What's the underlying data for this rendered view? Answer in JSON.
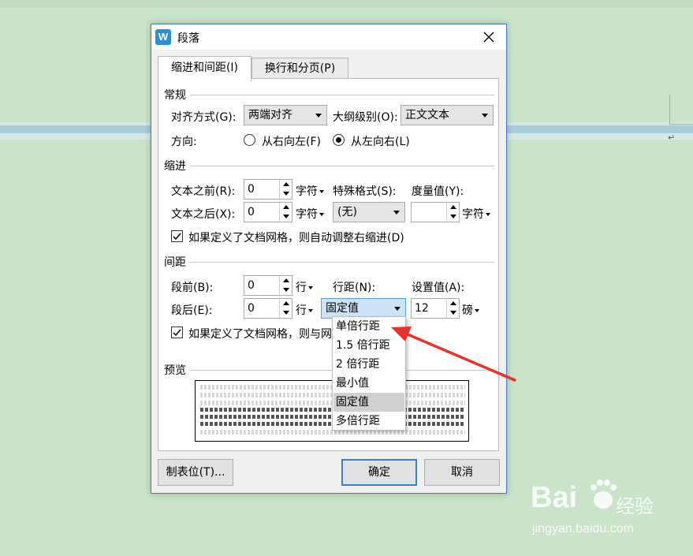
{
  "dialog": {
    "title": "段落",
    "app_icon_letter": "W",
    "tabs": [
      {
        "label": "缩进和间距(I)",
        "active": true
      },
      {
        "label": "换行和分页(P)",
        "active": false
      }
    ],
    "general": {
      "section_title": "常规",
      "align_label": "对齐方式(G):",
      "align_value": "两端对齐",
      "outline_label": "大纲级别(O):",
      "outline_value": "正文文本",
      "direction_label": "方向:",
      "rtl_label": "从右向左(F)",
      "ltr_label": "从左向右(L)",
      "direction_selected": "ltr"
    },
    "indent": {
      "section_title": "缩进",
      "before_label": "文本之前(R):",
      "before_value": "0",
      "before_unit": "字符",
      "after_label": "文本之后(X):",
      "after_value": "0",
      "after_unit": "字符",
      "special_label": "特殊格式(S):",
      "special_value": "(无)",
      "measure_label": "度量值(Y):",
      "measure_value": "",
      "measure_unit": "字符",
      "auto_adjust_label": "如果定义了文档网格，则自动调整右缩进(D)",
      "auto_adjust_checked": true
    },
    "spacing": {
      "section_title": "间距",
      "before_label": "段前(B):",
      "before_value": "0",
      "before_unit": "行",
      "after_label": "段后(E):",
      "after_value": "0",
      "after_unit": "行",
      "line_label": "行距(N):",
      "line_value": "固定值",
      "set_label": "设置值(A):",
      "set_value": "12",
      "set_unit": "磅",
      "grid_label": "如果定义了文档网格，则与网",
      "grid_checked": true
    },
    "preview": {
      "section_title": "预览"
    },
    "line_spacing_options": [
      "单倍行距",
      "1.5 倍行距",
      "2 倍行距",
      "最小值",
      "固定值",
      "多倍行距"
    ],
    "line_spacing_selected_index": 4,
    "buttons": {
      "tabs": "制表位(T)...",
      "ok": "确定",
      "cancel": "取消"
    }
  },
  "watermark": {
    "logo": "Bai",
    "brand_cn": "经验",
    "url": "jingyan.baidu.com"
  },
  "colors": {
    "background": "#c9e4c9",
    "dialog_border": "#3c7fc7",
    "arrow_red": "#e8322c",
    "selected_item": "#d0d0d0"
  }
}
